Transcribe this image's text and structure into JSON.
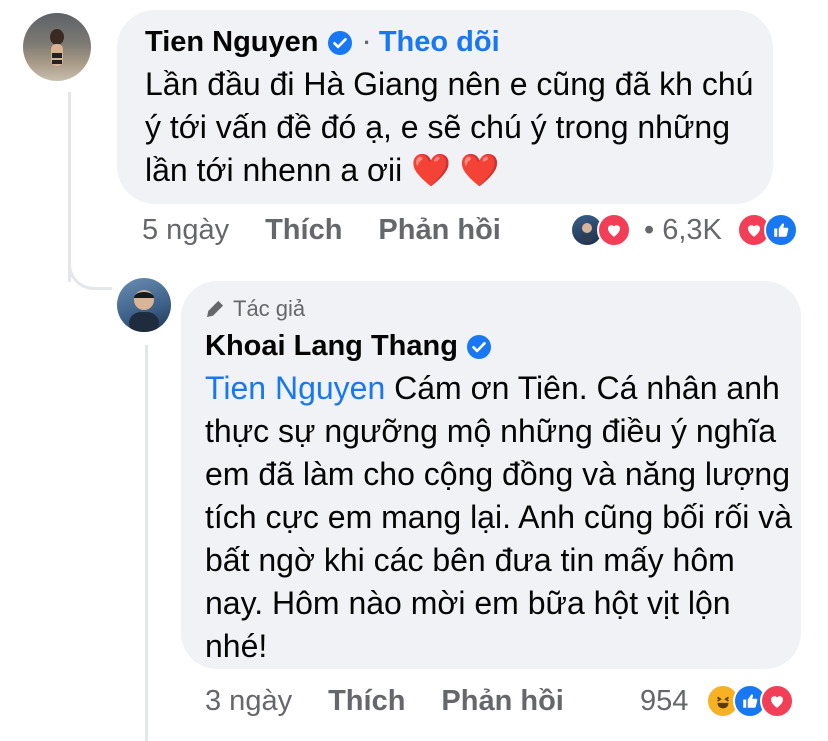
{
  "comment": {
    "author": "Tien Nguyen",
    "follow_label": "Theo dõi",
    "separator": "·",
    "text": "Lần đầu đi Hà Giang nên e cũng đã kh chú ý tới vấn đề đó ạ, e sẽ chú ý trong những lần tới nhenn a ơii ❤️ ❤️",
    "time": "5 ngày",
    "like_label": "Thích",
    "reply_label": "Phản hồi",
    "reaction_count": "• 6,3K",
    "reaction_types": [
      "like",
      "love"
    ]
  },
  "reply": {
    "author_badge": "Tác giả",
    "author": "Khoai Lang Thang",
    "mention": "Tien Nguyen",
    "text": "Cám ơn Tiên. Cá nhân anh thực sự ngưỡng mộ những điều ý nghĩa em đã làm cho cộng đồng và năng lượng tích cực em mang lại. Anh cũng bối rối và bất ngờ khi các bên đưa tin mấy hôm nay. Hôm nào mời em bữa hột vịt lộn nhé!",
    "time": "3 ngày",
    "like_label": "Thích",
    "reply_label": "Phản hồi",
    "reaction_count": "954",
    "reaction_types": [
      "haha",
      "like",
      "love"
    ]
  },
  "colors": {
    "link_blue": "#1877f2",
    "bubble_bg": "#f0f2f5",
    "secondary_text": "#65676b",
    "love_red": "#f33e58",
    "haha_yellow": "#f7b125"
  },
  "icons": [
    "verified-badge-icon",
    "pencil-icon",
    "like-reaction-icon",
    "love-reaction-icon",
    "haha-reaction-icon"
  ]
}
